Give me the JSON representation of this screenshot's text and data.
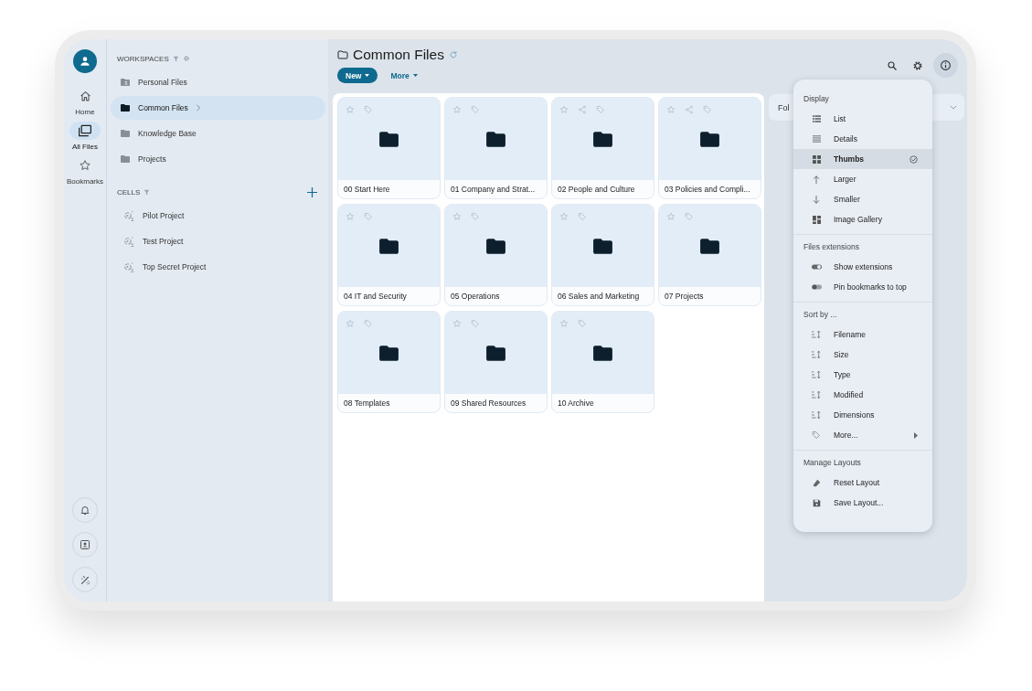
{
  "rail": {
    "items": [
      {
        "kind": "home",
        "label": "Home",
        "selected": false
      },
      {
        "kind": "files",
        "label": "All Files",
        "selected": true
      },
      {
        "kind": "bookmarks",
        "label": "Bookmarks",
        "selected": false
      }
    ]
  },
  "sidebar": {
    "workspaces_title": "WORKSPACES",
    "workspaces": [
      {
        "kind": "personal",
        "label": "Personal Files",
        "selected": false
      },
      {
        "kind": "folder",
        "label": "Common Files",
        "selected": true
      },
      {
        "kind": "folder",
        "label": "Knowledge Base",
        "selected": false
      },
      {
        "kind": "folder",
        "label": "Projects",
        "selected": false
      }
    ],
    "cells_title": "CELLS",
    "cells": [
      {
        "label": "Pilot Project"
      },
      {
        "label": "Test Project"
      },
      {
        "label": "Top Secret Project"
      }
    ]
  },
  "header": {
    "title": "Common Files",
    "new_button": "New",
    "more_button": "More"
  },
  "files": [
    {
      "name": "00 Start Here",
      "shared": false
    },
    {
      "name": "01 Company and Strat...",
      "shared": false
    },
    {
      "name": "02 People and Culture",
      "shared": true
    },
    {
      "name": "03 Policies and Compli...",
      "shared": true
    },
    {
      "name": "04 IT and Security",
      "shared": false
    },
    {
      "name": "05 Operations",
      "shared": false
    },
    {
      "name": "06 Sales and Marketing",
      "shared": false
    },
    {
      "name": "07 Projects",
      "shared": false
    },
    {
      "name": "08 Templates",
      "shared": false
    },
    {
      "name": "09 Shared Resources",
      "shared": false
    },
    {
      "name": "10 Archive",
      "shared": false
    }
  ],
  "right_panel": {
    "select": "Fol"
  },
  "menu": {
    "sections": [
      {
        "title": "Display",
        "items": [
          {
            "kind": "list",
            "label": "List",
            "selected": false
          },
          {
            "kind": "details",
            "label": "Details",
            "selected": false
          },
          {
            "kind": "thumbs",
            "label": "Thumbs",
            "selected": true
          },
          {
            "kind": "larger",
            "label": "Larger",
            "selected": false
          },
          {
            "kind": "smaller",
            "label": "Smaller",
            "selected": false
          },
          {
            "kind": "gallery",
            "label": "Image Gallery",
            "selected": false
          }
        ]
      },
      {
        "title": "Files extensions",
        "items": [
          {
            "kind": "toggle",
            "label": "Show extensions",
            "on": true
          },
          {
            "kind": "toggle",
            "label": "Pin bookmarks to top",
            "on": false
          }
        ]
      },
      {
        "title": "Sort by ...",
        "items": [
          {
            "kind": "sort",
            "label": "Filename",
            "submenu": false
          },
          {
            "kind": "sort",
            "label": "Size",
            "submenu": false
          },
          {
            "kind": "sort",
            "label": "Type",
            "submenu": false
          },
          {
            "kind": "sort",
            "label": "Modified",
            "submenu": false
          },
          {
            "kind": "sort",
            "label": "Dimensions",
            "submenu": false
          },
          {
            "kind": "tag",
            "label": "More...",
            "submenu": true
          }
        ]
      },
      {
        "title": "Manage Layouts",
        "items": [
          {
            "kind": "eraser",
            "label": "Reset Layout"
          },
          {
            "kind": "save",
            "label": "Save Layout..."
          }
        ]
      }
    ]
  }
}
